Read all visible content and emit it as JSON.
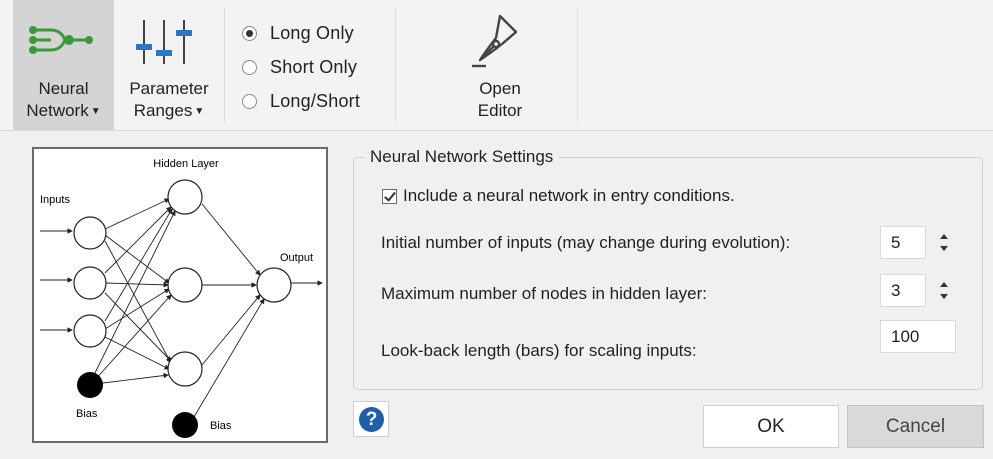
{
  "ribbon": {
    "neural_network": {
      "line1": "Neural",
      "line2": "Network"
    },
    "parameter_ranges": {
      "line1": "Parameter",
      "line2": "Ranges"
    },
    "position_modes": [
      "Long Only",
      "Short Only",
      "Long/Short"
    ],
    "selected_mode": "Long Only",
    "open_editor": {
      "line1": "Open",
      "line2": "Editor"
    }
  },
  "diagram": {
    "hidden_label": "Hidden Layer",
    "inputs_label": "Inputs",
    "output_label": "Output",
    "bias_label": "Bias"
  },
  "settings": {
    "title": "Neural Network Settings",
    "include_label": "Include a neural network in entry conditions.",
    "include_checked": true,
    "inputs_label": "Initial number of inputs (may change during evolution):",
    "inputs_value": "5",
    "nodes_label": "Maximum number of nodes in hidden layer:",
    "nodes_value": "3",
    "lookback_label": "Look-back length (bars) for scaling inputs:",
    "lookback_value": "100"
  },
  "buttons": {
    "help": "?",
    "ok": "OK",
    "cancel": "Cancel"
  },
  "colors": {
    "icon_green": "#3a9a3a",
    "icon_blue": "#2f77c6",
    "help_blue": "#1e5fa8"
  }
}
